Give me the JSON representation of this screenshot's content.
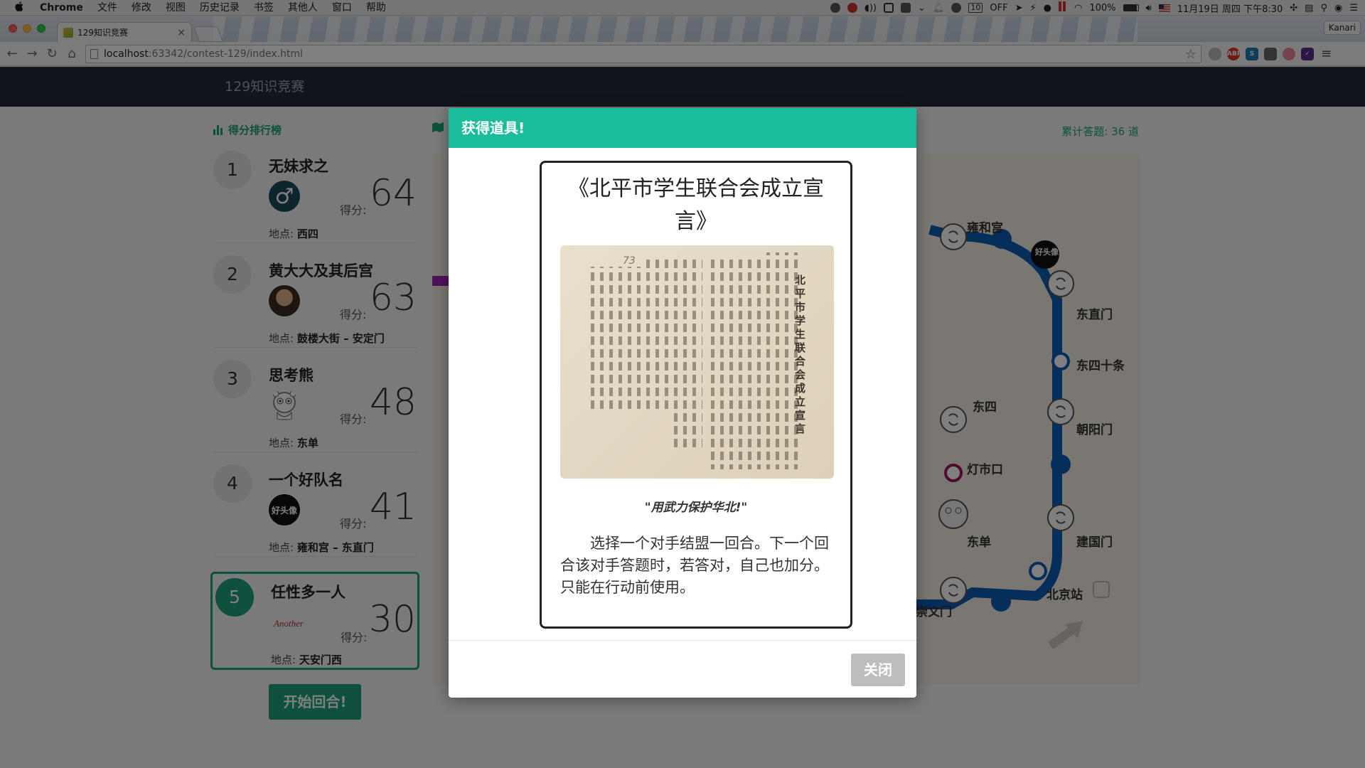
{
  "menubar": {
    "app": "Chrome",
    "items": [
      "文件",
      "修改",
      "视图",
      "历史记录",
      "书签",
      "其他人",
      "窗口",
      "帮助"
    ],
    "tray": {
      "off_label": "OFF",
      "box_label": "10",
      "battery": "100%",
      "datetime": "11月19日 周四 下午8:30"
    }
  },
  "browser": {
    "tab_title": "129知识竞赛",
    "tab_close": "×",
    "profile": "Kanari",
    "url_host": "localhost",
    "url_path": ":63342/contest-129/index.html"
  },
  "app": {
    "brand": "129知识竞赛",
    "leaderboard_title": "得分排行榜",
    "total_label": "累计答题:",
    "total_value": "36 道",
    "score_label": "得分:",
    "location_label": "地点:",
    "start_button": "开始回合!"
  },
  "leaderboard": [
    {
      "rank": "1",
      "name": "无妹求之",
      "score": "64",
      "location": "西四"
    },
    {
      "rank": "2",
      "name": "黄大大及其后宫",
      "score": "63",
      "location": "鼓楼大街 – 安定门"
    },
    {
      "rank": "3",
      "name": "思考熊",
      "score": "48",
      "location": "东单"
    },
    {
      "rank": "4",
      "name": "一个好队名",
      "score": "41",
      "location": "雍和宫 – 东直门"
    },
    {
      "rank": "5",
      "name": "任性多一人",
      "score": "30",
      "location": "天安门西",
      "avatar_text": "Another"
    }
  ],
  "map": {
    "stations": {
      "yonghegong": "雍和宫",
      "dongzhimen": "东直门",
      "dongsishitiao": "东四十条",
      "dongsi": "东四",
      "chaoyangmen": "朝阳门",
      "dengshikou": "灯市口",
      "dongdan": "东单",
      "jianguomen": "建国门",
      "beijingzhan": "北京站",
      "chongwenmen": "崇文门"
    },
    "avatar_badge": "好头像",
    "colors": {
      "line2": "#0a5fb4",
      "line5": "#a3145e",
      "line1": "#c4161c",
      "line6": "#d29700",
      "purple_line": "#9c27b0"
    }
  },
  "modal": {
    "header": "获得道具!",
    "card_title": "《北平市学生联合会成立宣言》",
    "doc_heading": "北平市学生联合会成立宣言",
    "doc_number": "73",
    "quote": "\"用武力保护华北!\"",
    "description": "选择一个对手结盟一回合。下一个回合该对手答题时，若答对，自己也加分。只能在行动前使用。",
    "close_button": "关闭"
  },
  "colors": {
    "accent": "#1abc9c",
    "brand_green": "#1ba17c",
    "navbar": "#232b37"
  }
}
